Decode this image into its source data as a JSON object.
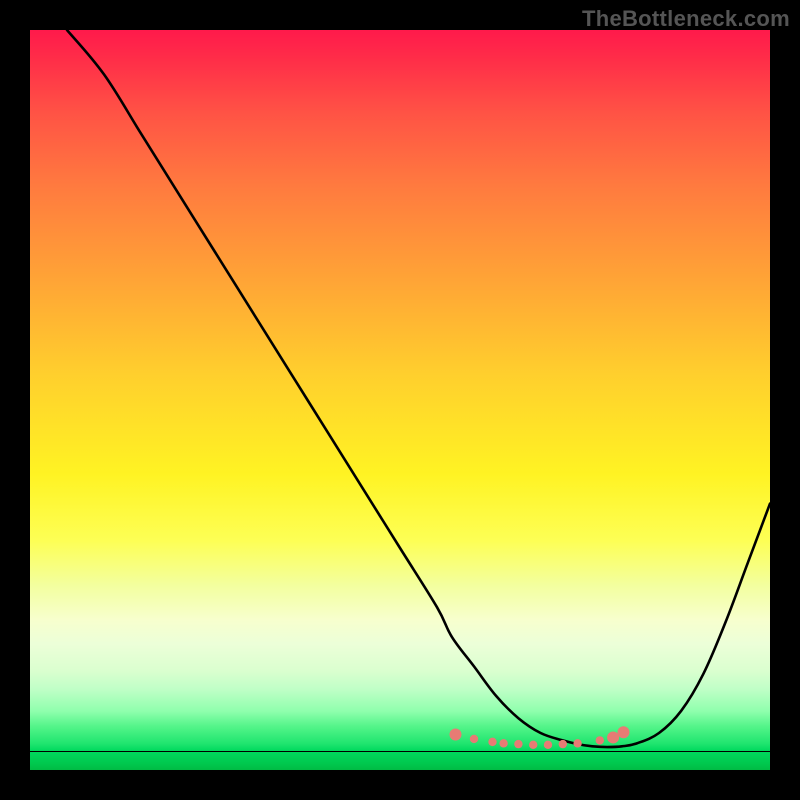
{
  "watermark": "TheBottleneck.com",
  "chart_data": {
    "type": "line",
    "title": "",
    "xlabel": "",
    "ylabel": "",
    "xlim": [
      0,
      100
    ],
    "ylim": [
      0,
      100
    ],
    "series": [
      {
        "name": "bottleneck-curve",
        "x": [
          5,
          10,
          15,
          20,
          25,
          30,
          35,
          40,
          45,
          50,
          55,
          57,
          60,
          63,
          66,
          69,
          72,
          74,
          76,
          78,
          80,
          82,
          85,
          88,
          91,
          94,
          97,
          100
        ],
        "y": [
          100,
          94,
          86,
          78,
          70,
          62,
          54,
          46,
          38,
          30,
          22,
          18,
          14,
          10,
          7,
          5,
          4,
          3.5,
          3.2,
          3.1,
          3.2,
          3.6,
          5,
          8,
          13,
          20,
          28,
          36
        ]
      }
    ],
    "beads": {
      "name": "highlight-beads",
      "color": "#e77b74",
      "cap_radius": 6,
      "mid_radius": 4.2,
      "points": [
        {
          "x": 57.5,
          "y": 4.8,
          "r": "cap"
        },
        {
          "x": 60.0,
          "y": 4.2,
          "r": "mid"
        },
        {
          "x": 62.5,
          "y": 3.8,
          "r": "mid"
        },
        {
          "x": 64.0,
          "y": 3.6,
          "r": "mid"
        },
        {
          "x": 66.0,
          "y": 3.5,
          "r": "mid"
        },
        {
          "x": 68.0,
          "y": 3.4,
          "r": "mid"
        },
        {
          "x": 70.0,
          "y": 3.4,
          "r": "mid"
        },
        {
          "x": 72.0,
          "y": 3.5,
          "r": "mid"
        },
        {
          "x": 74.0,
          "y": 3.6,
          "r": "mid"
        },
        {
          "x": 77.0,
          "y": 4.0,
          "r": "mid"
        },
        {
          "x": 78.8,
          "y": 4.4,
          "r": "cap"
        },
        {
          "x": 80.2,
          "y": 5.1,
          "r": "cap"
        }
      ]
    },
    "gradient_bands": [
      {
        "top": 0.0,
        "height": 75.0,
        "css": "linear-gradient(to bottom, #ff1a4b 0%, #ff3048 6%, #ff5345 15%, #ff7a3f 28%, #ffa436 45%, #ffcf2d 62%, #fff323 80%, #fdff55 92%, #f3ff9e 100%)"
      },
      {
        "top": 75.0,
        "height": 8.0,
        "css": "linear-gradient(to bottom, #f3ff9e 0%, #f7ffce 60%, #ecffd8 100%)"
      },
      {
        "top": 83.0,
        "height": 6.0,
        "css": "linear-gradient(to bottom, #ecffd8 0%, #daffcf 60%, #c0ffc7 100%)"
      },
      {
        "top": 89.0,
        "height": 5.0,
        "css": "linear-gradient(to bottom, #c0ffc7 0%, #8fffad 60%, #55f58a 100%)"
      },
      {
        "top": 94.0,
        "height": 3.5,
        "css": "linear-gradient(to bottom, #55f58a 0%, #20e56f 70%, #00d95d 100%)"
      },
      {
        "top": 97.5,
        "height": 2.5,
        "css": "linear-gradient(to bottom, #00d95d 0%, #00c94f 60%, #00bb44 100%)"
      }
    ]
  }
}
